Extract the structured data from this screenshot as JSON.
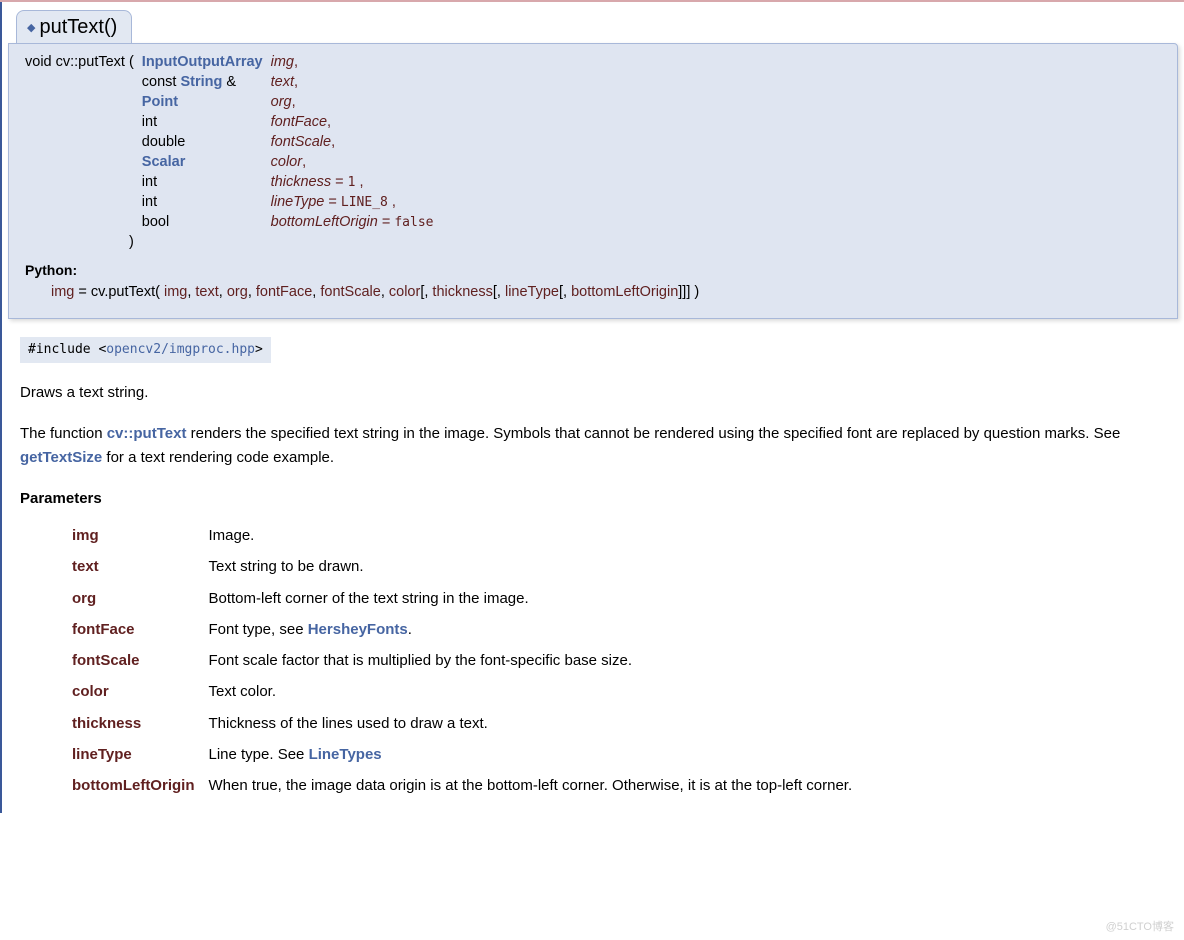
{
  "title": "putText()",
  "signature": {
    "returns": "void",
    "qualified": "cv::putText",
    "open": "(",
    "close": ")",
    "params": [
      {
        "type_prefix": "",
        "type_link": "InputOutputArray",
        "type_suffix": "",
        "name": "img",
        "sep": ","
      },
      {
        "type_prefix": "const ",
        "type_link": "String",
        "type_suffix": " &",
        "name": "text",
        "sep": ","
      },
      {
        "type_prefix": "",
        "type_link": "Point",
        "type_suffix": "",
        "name": "org",
        "sep": ","
      },
      {
        "type_prefix": "int",
        "type_link": "",
        "type_suffix": "",
        "name": "fontFace",
        "sep": ","
      },
      {
        "type_prefix": "double",
        "type_link": "",
        "type_suffix": "",
        "name": "fontScale",
        "sep": ","
      },
      {
        "type_prefix": "",
        "type_link": "Scalar",
        "type_suffix": "",
        "name": "color",
        "sep": ","
      },
      {
        "type_prefix": "int",
        "type_link": "",
        "type_suffix": "",
        "name": "thickness",
        "default_op": " = ",
        "default_val": "1",
        "sep": ","
      },
      {
        "type_prefix": "int",
        "type_link": "",
        "type_suffix": "",
        "name": "lineType",
        "default_op": " = ",
        "default_val": "LINE_8",
        "sep": ","
      },
      {
        "type_prefix": "bool",
        "type_link": "",
        "type_suffix": "",
        "name": "bottomLeftOrigin",
        "default_op": " = ",
        "default_val": "false",
        "sep": ""
      }
    ]
  },
  "python": {
    "label": "Python:",
    "ret": "img",
    "eq": " = ",
    "call": "cv.putText(",
    "args": [
      "img",
      "text",
      "org",
      "fontFace",
      "fontScale",
      "color"
    ],
    "optional_open": "[, ",
    "optional_names": [
      "thickness",
      "lineType",
      "bottomLeftOrigin"
    ],
    "optional_close": "]]] )"
  },
  "include": {
    "directive": "#include",
    "open": "<",
    "path": "opencv2/imgproc.hpp",
    "close": ">"
  },
  "brief": "Draws a text string.",
  "detail": {
    "pre": "The function ",
    "link1": "cv::putText",
    "mid": " renders the specified text string in the image. Symbols that cannot be rendered using the specified font are replaced by question marks. See ",
    "link2": "getTextSize",
    "post": " for a text rendering code example."
  },
  "params_heading": "Parameters",
  "params_table": [
    {
      "name": "img",
      "desc": "Image."
    },
    {
      "name": "text",
      "desc": "Text string to be drawn."
    },
    {
      "name": "org",
      "desc": "Bottom-left corner of the text string in the image."
    },
    {
      "name": "fontFace",
      "desc_pre": "Font type, see ",
      "desc_link": "HersheyFonts",
      "desc_post": "."
    },
    {
      "name": "fontScale",
      "desc": "Font scale factor that is multiplied by the font-specific base size."
    },
    {
      "name": "color",
      "desc": "Text color."
    },
    {
      "name": "thickness",
      "desc": "Thickness of the lines used to draw a text."
    },
    {
      "name": "lineType",
      "desc_pre": "Line type. See ",
      "desc_link": "LineTypes",
      "desc_post": ""
    },
    {
      "name": "bottomLeftOrigin",
      "desc": "When true, the image data origin is at the bottom-left corner. Otherwise, it is at the top-left corner."
    }
  ],
  "watermark": "@51CTO博客"
}
